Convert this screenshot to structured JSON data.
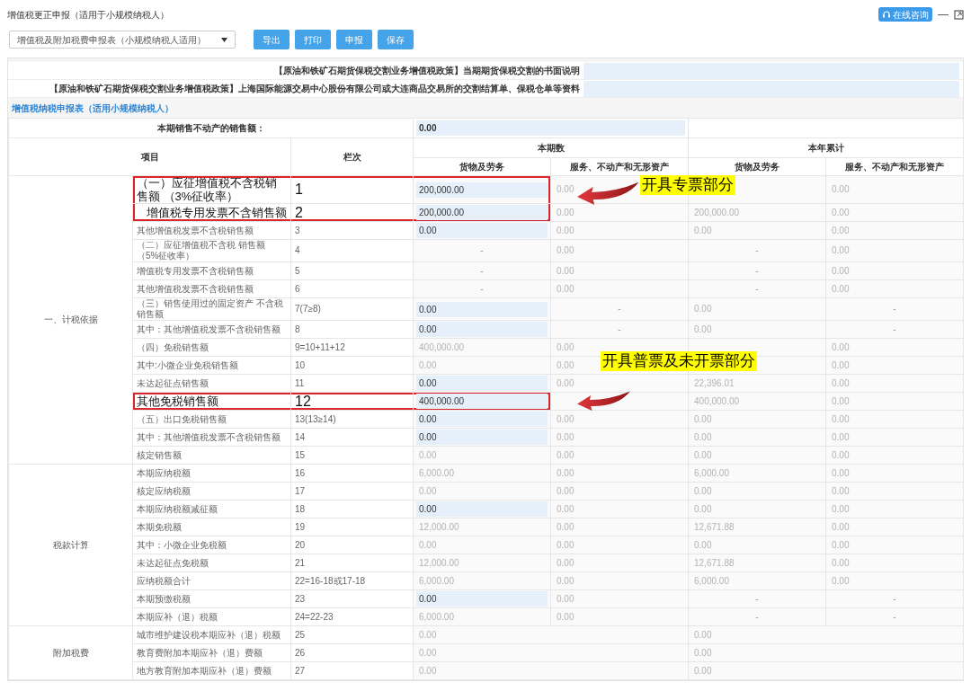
{
  "window": {
    "title": "增值税更正申报（适用于小规模纳税人）",
    "consult_button": "在线咨询",
    "minimize": "—"
  },
  "toolbar": {
    "form_select": "增值税及附加税费申报表（小规模纳税人适用）",
    "buttons": [
      "导出",
      "打印",
      "申报",
      "保存"
    ]
  },
  "notices": [
    {
      "label": "【原油和铁矿石期货保税交割业务增值税政策】当期期货保税交割的书面说明"
    },
    {
      "label": "【原油和铁矿石期货保税交割业务增值税政策】上海国际能源交易中心股份有限公司或大连商品交易所的交割结算单、保税仓单等资料"
    }
  ],
  "form_title": "增值税纳税申报表（适用小规模纳税人）",
  "table": {
    "realestate_label": "本期销售不动产的销售额：",
    "realestate_value": "0.00",
    "headers": {
      "item": "项目",
      "line": "栏次",
      "current": "本期数",
      "ytd": "本年累计",
      "sub": [
        "货物及劳务",
        "服务、不动产和无形资产",
        "货物及劳务",
        "服务、不动产和无形资产"
      ]
    },
    "sections": [
      {
        "name": "一、计税依据",
        "rows": [
          {
            "label": "（一）应征增值税不含税销售额 （3%征收率）",
            "line": "1",
            "boxed": true,
            "cells": [
              {
                "kind": "input",
                "value": "200,000.00"
              },
              {
                "kind": "readonly",
                "value": "0.00"
              },
              {
                "kind": "blank"
              },
              {
                "kind": "readonly",
                "value": "0.00"
              }
            ]
          },
          {
            "label": "增值税专用发票不含销售额",
            "line": "2",
            "boxed": true,
            "cells": [
              {
                "kind": "input",
                "value": "200,000.00"
              },
              {
                "kind": "readonly",
                "value": "0.00"
              },
              {
                "kind": "readonly",
                "value": "200,000.00"
              },
              {
                "kind": "readonly",
                "value": "0.00"
              }
            ]
          },
          {
            "label": "其他增值税发票不含税销售额",
            "line": "3",
            "boxed": false,
            "cells": [
              {
                "kind": "input",
                "value": "0.00"
              },
              {
                "kind": "readonly",
                "value": "0.00"
              },
              {
                "kind": "readonly",
                "value": "0.00"
              },
              {
                "kind": "readonly",
                "value": "0.00"
              }
            ]
          },
          {
            "label": "（二）应征增值税不含税 销售额（5%征收率）",
            "line": "4",
            "boxed": false,
            "cells": [
              {
                "kind": "dash",
                "value": "-"
              },
              {
                "kind": "readonly",
                "value": "0.00"
              },
              {
                "kind": "dash",
                "value": "-"
              },
              {
                "kind": "readonly",
                "value": "0.00"
              }
            ]
          },
          {
            "label": "增值税专用发票不含税销售额",
            "line": "5",
            "boxed": false,
            "cells": [
              {
                "kind": "dash",
                "value": "-"
              },
              {
                "kind": "readonly",
                "value": "0.00"
              },
              {
                "kind": "dash",
                "value": "-"
              },
              {
                "kind": "readonly",
                "value": "0.00"
              }
            ]
          },
          {
            "label": "其他增值税发票不含税销售额",
            "line": "6",
            "boxed": false,
            "cells": [
              {
                "kind": "dash",
                "value": "-"
              },
              {
                "kind": "readonly",
                "value": "0.00"
              },
              {
                "kind": "dash",
                "value": "-"
              },
              {
                "kind": "readonly",
                "value": "0.00"
              }
            ]
          },
          {
            "label": "（三）销售使用过的固定资产 不含税销售额",
            "line": "7(7≥8)",
            "boxed": false,
            "cells": [
              {
                "kind": "input",
                "value": "0.00"
              },
              {
                "kind": "dash",
                "value": "-"
              },
              {
                "kind": "readonly",
                "value": "0.00"
              },
              {
                "kind": "dash",
                "value": "-"
              }
            ]
          },
          {
            "label": "其中：其他增值税发票不含税销售额",
            "line": "8",
            "boxed": false,
            "cells": [
              {
                "kind": "input",
                "value": "0.00"
              },
              {
                "kind": "dash",
                "value": "-"
              },
              {
                "kind": "readonly",
                "value": "0.00"
              },
              {
                "kind": "dash",
                "value": "-"
              }
            ]
          },
          {
            "label": "（四）免税销售额",
            "line": "9=10+11+12",
            "boxed": false,
            "cells": [
              {
                "kind": "readonly",
                "value": "400,000.00"
              },
              {
                "kind": "readonly",
                "value": "0.00"
              },
              {
                "kind": "blank"
              },
              {
                "kind": "readonly",
                "value": "0.00"
              }
            ]
          },
          {
            "label": "其中:小微企业免税销售额",
            "line": "10",
            "boxed": false,
            "cells": [
              {
                "kind": "readonly",
                "value": "0.00"
              },
              {
                "kind": "readonly",
                "value": "0.00"
              },
              {
                "kind": "blank"
              },
              {
                "kind": "readonly",
                "value": "0.00"
              }
            ]
          },
          {
            "label": "未达起征点销售额",
            "line": "11",
            "boxed": false,
            "cells": [
              {
                "kind": "input",
                "value": "0.00"
              },
              {
                "kind": "readonly",
                "value": "0.00"
              },
              {
                "kind": "readonly",
                "value": "22,396.01"
              },
              {
                "kind": "readonly",
                "value": "0.00"
              }
            ]
          },
          {
            "label": "其他免税销售额",
            "line": "12",
            "boxed": true,
            "cells": [
              {
                "kind": "input",
                "value": "400,000.00"
              },
              {
                "kind": "blank"
              },
              {
                "kind": "readonly",
                "value": "400,000.00"
              },
              {
                "kind": "readonly",
                "value": "0.00"
              }
            ]
          },
          {
            "label": "（五）出口免税销售额",
            "line": "13(13≥14)",
            "boxed": false,
            "cells": [
              {
                "kind": "input",
                "value": "0.00"
              },
              {
                "kind": "readonly",
                "value": "0.00"
              },
              {
                "kind": "readonly",
                "value": "0.00"
              },
              {
                "kind": "readonly",
                "value": "0.00"
              }
            ]
          },
          {
            "label": "其中：其他增值税发票不含税销售额",
            "line": "14",
            "boxed": false,
            "cells": [
              {
                "kind": "input",
                "value": "0.00"
              },
              {
                "kind": "readonly",
                "value": "0.00"
              },
              {
                "kind": "readonly",
                "value": "0.00"
              },
              {
                "kind": "readonly",
                "value": "0.00"
              }
            ]
          },
          {
            "label": "核定销售额",
            "line": "15",
            "boxed": false,
            "cells": [
              {
                "kind": "readonly",
                "value": "0.00"
              },
              {
                "kind": "readonly",
                "value": "0.00"
              },
              {
                "kind": "readonly",
                "value": "0.00"
              },
              {
                "kind": "readonly",
                "value": "0.00"
              }
            ]
          }
        ]
      },
      {
        "name": "税款计算",
        "rows": [
          {
            "label": "本期应纳税额",
            "line": "16",
            "boxed": false,
            "cells": [
              {
                "kind": "readonly",
                "value": "6,000.00"
              },
              {
                "kind": "readonly",
                "value": "0.00"
              },
              {
                "kind": "readonly",
                "value": "6,000.00"
              },
              {
                "kind": "readonly",
                "value": "0.00"
              }
            ]
          },
          {
            "label": "核定应纳税额",
            "line": "17",
            "boxed": false,
            "cells": [
              {
                "kind": "readonly",
                "value": "0.00"
              },
              {
                "kind": "readonly",
                "value": "0.00"
              },
              {
                "kind": "readonly",
                "value": "0.00"
              },
              {
                "kind": "readonly",
                "value": "0.00"
              }
            ]
          },
          {
            "label": "本期应纳税额减征额",
            "line": "18",
            "boxed": false,
            "cells": [
              {
                "kind": "input",
                "value": "0.00"
              },
              {
                "kind": "readonly",
                "value": "0.00"
              },
              {
                "kind": "readonly",
                "value": "0.00"
              },
              {
                "kind": "readonly",
                "value": "0.00"
              }
            ]
          },
          {
            "label": "本期免税额",
            "line": "19",
            "boxed": false,
            "cells": [
              {
                "kind": "readonly",
                "value": "12,000.00"
              },
              {
                "kind": "readonly",
                "value": "0.00"
              },
              {
                "kind": "readonly",
                "value": "12,671.88"
              },
              {
                "kind": "readonly",
                "value": "0.00"
              }
            ]
          },
          {
            "label": "其中：小微企业免税额",
            "line": "20",
            "boxed": false,
            "cells": [
              {
                "kind": "readonly",
                "value": "0.00"
              },
              {
                "kind": "readonly",
                "value": "0.00"
              },
              {
                "kind": "readonly",
                "value": "0.00"
              },
              {
                "kind": "readonly",
                "value": "0.00"
              }
            ]
          },
          {
            "label": "未达起征点免税额",
            "line": "21",
            "boxed": false,
            "cells": [
              {
                "kind": "readonly",
                "value": "12,000.00"
              },
              {
                "kind": "readonly",
                "value": "0.00"
              },
              {
                "kind": "readonly",
                "value": "12,671.88"
              },
              {
                "kind": "readonly",
                "value": "0.00"
              }
            ]
          },
          {
            "label": "应纳税额合计",
            "line": "22=16-18或17-18",
            "boxed": false,
            "cells": [
              {
                "kind": "readonly",
                "value": "6,000.00"
              },
              {
                "kind": "readonly",
                "value": "0.00"
              },
              {
                "kind": "readonly",
                "value": "6,000.00"
              },
              {
                "kind": "readonly",
                "value": "0.00"
              }
            ]
          },
          {
            "label": "本期预缴税额",
            "line": "23",
            "boxed": false,
            "cells": [
              {
                "kind": "input",
                "value": "0.00"
              },
              {
                "kind": "readonly",
                "value": "0.00"
              },
              {
                "kind": "dash",
                "value": "-"
              },
              {
                "kind": "dash",
                "value": "-"
              }
            ]
          },
          {
            "label": "本期应补（退）税额",
            "line": "24=22-23",
            "boxed": false,
            "cells": [
              {
                "kind": "readonly",
                "value": "6,000.00"
              },
              {
                "kind": "readonly",
                "value": "0.00"
              },
              {
                "kind": "dash",
                "value": "-"
              },
              {
                "kind": "dash",
                "value": "-"
              }
            ]
          }
        ]
      },
      {
        "name": "附加税费",
        "rows": [
          {
            "label": "城市维护建设税本期应补（退）税额",
            "line": "25",
            "boxed": false,
            "cells": [
              {
                "kind": "wide",
                "value": "0.00"
              },
              {
                "kind": "wide",
                "value": "0.00"
              }
            ]
          },
          {
            "label": "教育费附加本期应补（退）费额",
            "line": "26",
            "boxed": false,
            "cells": [
              {
                "kind": "wide",
                "value": "0.00"
              },
              {
                "kind": "wide",
                "value": "0.00"
              }
            ]
          },
          {
            "label": "地方教育附加本期应补（退）费额",
            "line": "27",
            "boxed": false,
            "cells": [
              {
                "kind": "wide",
                "value": "0.00"
              },
              {
                "kind": "wide",
                "value": "0.00"
              }
            ]
          }
        ]
      }
    ]
  },
  "callouts": [
    {
      "text": "开具专票部分"
    },
    {
      "text": "开具普票及未开票部分"
    }
  ]
}
